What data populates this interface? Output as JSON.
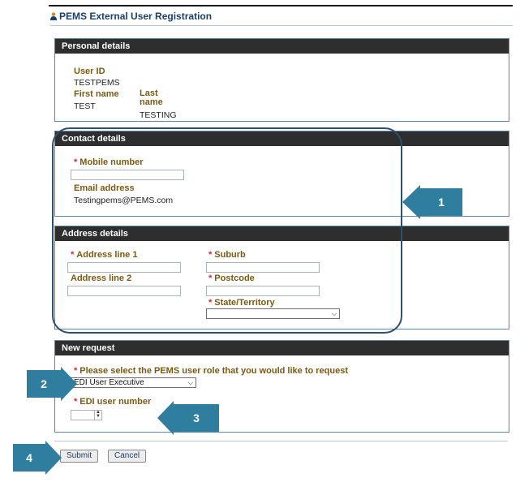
{
  "page": {
    "title": "PEMS External User Registration"
  },
  "personal": {
    "header": "Personal details",
    "user_id_label": "User ID",
    "user_id_value": "TESTPEMS",
    "first_name_label": "First name",
    "first_name_value": "TEST",
    "last_name_label": "Last name",
    "last_name_value": "TESTING"
  },
  "contact": {
    "header": "Contact details",
    "mobile_label": "Mobile number",
    "mobile_value": "",
    "email_label": "Email address",
    "email_value": "Testingpems@PEMS.com"
  },
  "address": {
    "header": "Address details",
    "line1_label": "Address line 1",
    "line2_label": "Address line 2",
    "suburb_label": "Suburb",
    "postcode_label": "Postcode",
    "state_label": "State/Territory",
    "state_value": ""
  },
  "request": {
    "header": "New request",
    "role_label": "Please select the PEMS user role that you would like to request",
    "role_value": "EDI User Executive",
    "edi_label": "EDI user number",
    "edi_value": ""
  },
  "actions": {
    "submit": "Submit",
    "cancel": "Cancel"
  },
  "callouts": [
    "1",
    "2",
    "3",
    "4"
  ],
  "colors": {
    "callout": "#2f7ea0",
    "header_bar": "#2e2e2e",
    "label": "#7a5a12",
    "required": "#d0263c",
    "title": "#1b3f6b"
  }
}
